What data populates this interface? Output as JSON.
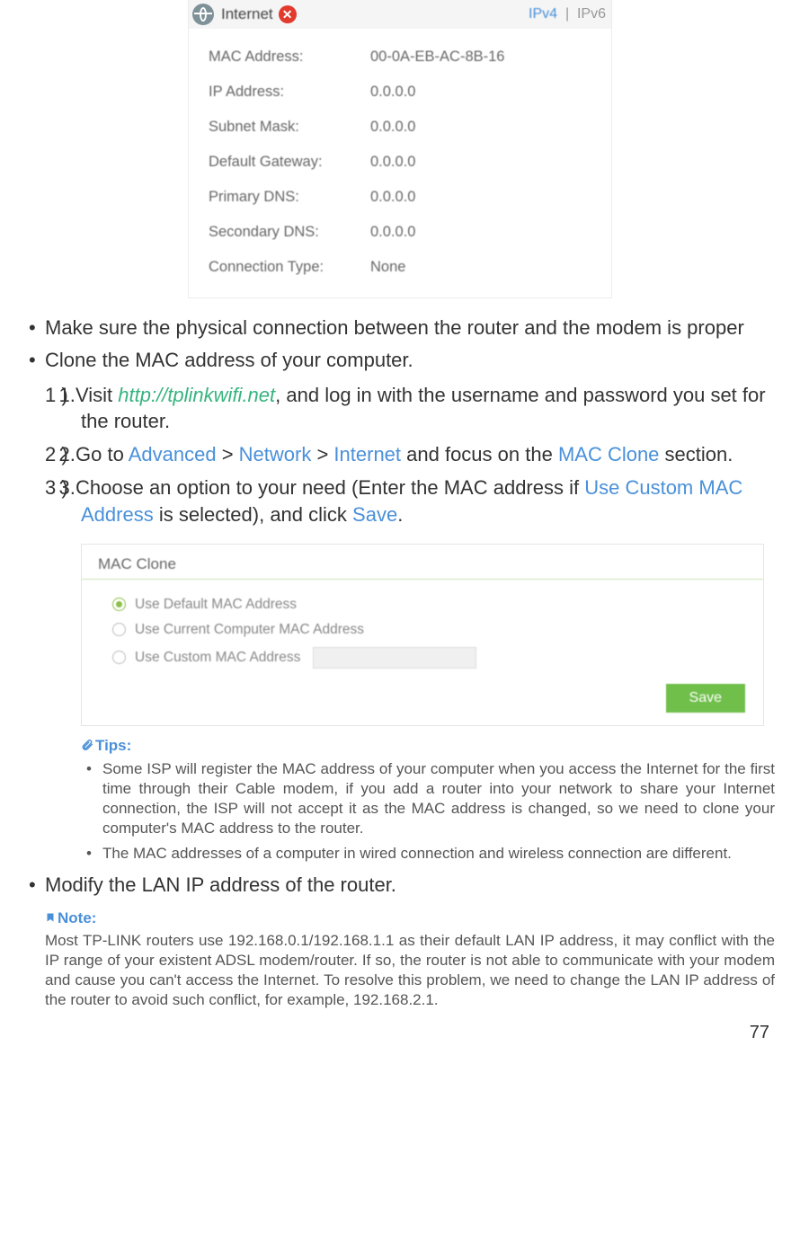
{
  "status_panel": {
    "title": "Internet",
    "ipv4": "IPv4",
    "ipv6": "IPv6",
    "rows": [
      {
        "label": "MAC Address:",
        "value": "00-0A-EB-AC-8B-16"
      },
      {
        "label": "IP Address:",
        "value": "0.0.0.0"
      },
      {
        "label": "Subnet Mask:",
        "value": "0.0.0.0"
      },
      {
        "label": "Default Gateway:",
        "value": "0.0.0.0"
      },
      {
        "label": "Primary DNS:",
        "value": "0.0.0.0"
      },
      {
        "label": "Secondary DNS:",
        "value": "0.0.0.0"
      },
      {
        "label": "Connection Type:",
        "value": "None"
      }
    ]
  },
  "bullets": {
    "b1": "Make sure the physical connection between the router and the modem is proper",
    "b2": "Clone the MAC address of your computer.",
    "b3": "Modify the LAN IP address of the router."
  },
  "steps": {
    "s1": {
      "num": "1 )",
      "pre": "Visit ",
      "link": "http://tplinkwifi.net",
      "post": ", and log in with the username and password you set for the router."
    },
    "s2": {
      "num": "2 )",
      "t1": "Go to ",
      "a": "Advanced",
      "gt1": " > ",
      "n": "Network",
      "gt2": " > ",
      "i": "Internet",
      "t2": " and focus on the ",
      "m": "MAC Clone",
      "t3": " section."
    },
    "s3": {
      "num": "3 )",
      "t1": "Choose an option to your need (Enter the MAC address if ",
      "u": "Use Custom MAC Address",
      "t2": " is selected), and click ",
      "s": "Save",
      "t3": "."
    }
  },
  "mac_clone": {
    "title": "MAC Clone",
    "opt1": "Use Default MAC Address",
    "opt2": "Use Current Computer MAC Address",
    "opt3": "Use Custom MAC Address",
    "save": "Save"
  },
  "tips": {
    "header": "Tips:",
    "t1": "Some ISP will register the MAC address of your computer when you access the Internet for the first time through their Cable modem, if you add a router into your network to share your Internet connection, the ISP will not accept it as the MAC address is changed, so we need to clone your computer's MAC address to the router.",
    "t2": "The MAC addresses of a computer in wired connection and wireless connection are different."
  },
  "note": {
    "header": "Note:",
    "body": "Most TP-LINK routers use 192.168.0.1/192.168.1.1 as their default LAN IP address, it may conflict with the IP range of your existent ADSL modem/router. If so, the router is not able to communicate with your modem and cause you can't access the Internet. To resolve this problem, we need to change the LAN IP address of the router to avoid such conflict, for example, 192.168.2.1."
  },
  "page": "77"
}
